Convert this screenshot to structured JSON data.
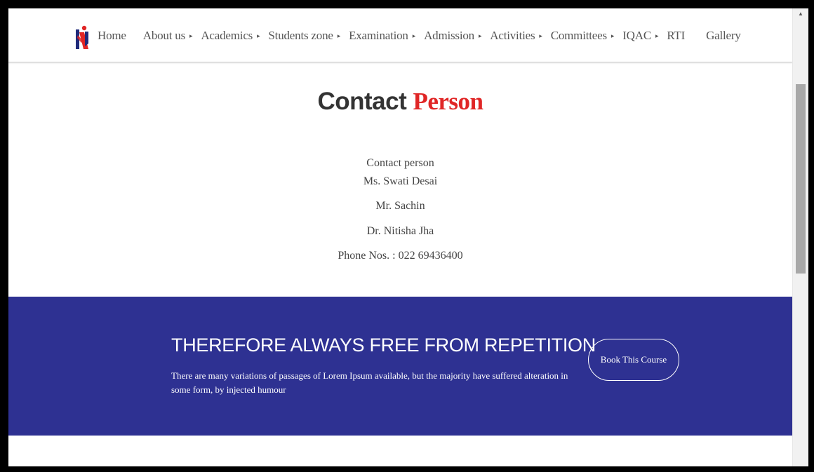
{
  "nav": {
    "items": [
      {
        "label": "Home",
        "has_caret": false
      },
      {
        "label": "About us",
        "has_caret": true
      },
      {
        "label": "Academics",
        "has_caret": true
      },
      {
        "label": "Students zone",
        "has_caret": true
      },
      {
        "label": "Examination",
        "has_caret": true
      },
      {
        "label": "Admission",
        "has_caret": true
      },
      {
        "label": "Activities",
        "has_caret": true
      },
      {
        "label": "Committees",
        "has_caret": true
      },
      {
        "label": "IQAC",
        "has_caret": true
      },
      {
        "label": "RTI",
        "has_caret": false
      },
      {
        "label": "Gallery",
        "has_caret": false
      }
    ],
    "caret_glyph": "▸"
  },
  "page": {
    "heading_main": "Contact",
    "heading_accent": "Person",
    "accent_color": "#e02626"
  },
  "contact": {
    "label": "Contact person",
    "people": [
      "Ms. Swati Desai",
      "Mr. Sachin",
      "Dr. Nitisha Jha"
    ],
    "phone": "Phone Nos. : 022 69436400"
  },
  "banner": {
    "title": "THEREFORE ALWAYS FREE FROM REPETITION",
    "text": "There are many variations of passages of Lorem Ipsum available, but the majority have suffered alteration in some form, by injected humour",
    "button_label": "Book This Course",
    "background_color": "#2e3192"
  },
  "scrollbar": {
    "up_glyph": "▲"
  }
}
